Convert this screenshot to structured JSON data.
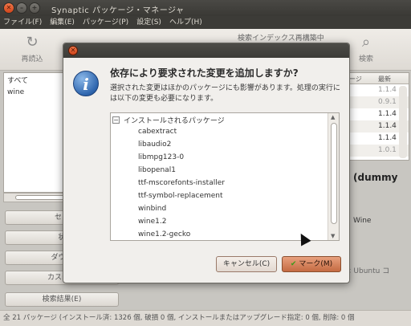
{
  "window": {
    "title": "Synaptic パッケージ・マネージャ",
    "menu": [
      "ファイル(F)",
      "編集(E)",
      "パッケージ(P)",
      "設定(S)",
      "ヘルプ(H)"
    ]
  },
  "toolbar": {
    "reload_label": "再読込",
    "search_label": "検索",
    "search_status": "検索インデックス再構築中"
  },
  "filters": {
    "items": [
      "すべて",
      "wine"
    ]
  },
  "side_buttons": [
    "セク",
    "状",
    "ダウン",
    "カスタム",
    "検索結果(E)"
  ],
  "package_table": {
    "headers": [
      "ージ",
      "最新"
    ],
    "versions": [
      "1.1.4",
      "0.9.1",
      "1.1.4",
      "1.1.4",
      "1.1.4",
      "1.0.1"
    ]
  },
  "description": {
    "title": "(dummy",
    "wine_text": "Wine",
    "ubuntu_text": "< Ubuntu コ"
  },
  "statusbar": {
    "text": "全 21 パッケージ (インストール済: 1326 個, 破損 0 個, インストールまたはアップグレード指定: 0 個, 削除: 0 個"
  },
  "dialog": {
    "heading": "依存により要求された変更を追加しますか?",
    "body": "選択された変更はほかのパッケージにも影響があります。処理の実行には以下の変更も必要になります。",
    "group_label": "インストールされるパッケージ",
    "packages": [
      "cabextract",
      "libaudio2",
      "libmpg123-0",
      "libopenal1",
      "ttf-mscorefonts-installer",
      "ttf-symbol-replacement",
      "winbind",
      "wine1.2",
      "wine1.2-gecko"
    ],
    "cancel_label": "キャンセル(C)",
    "mark_label": "マーク(M)"
  }
}
